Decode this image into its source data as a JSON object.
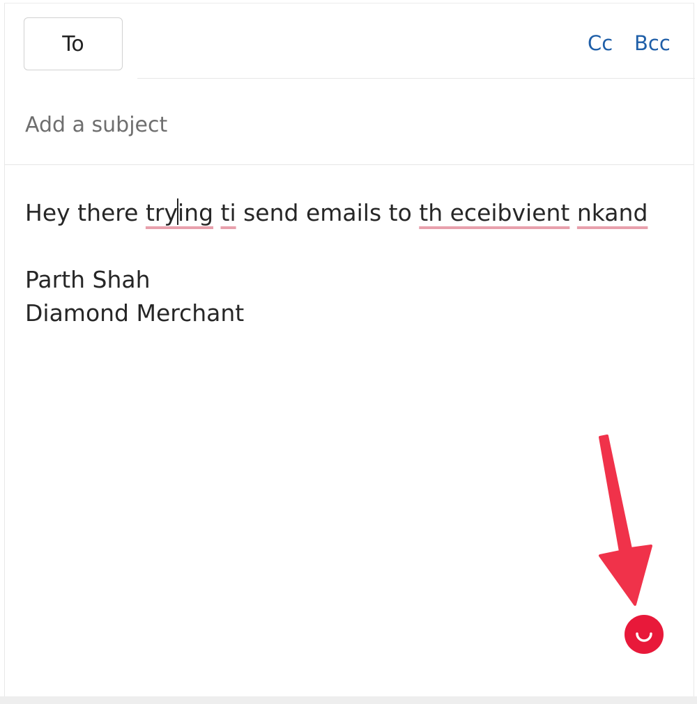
{
  "header": {
    "to_label": "To",
    "cc_label": "Cc",
    "bcc_label": "Bcc"
  },
  "subject": {
    "placeholder": "Add a subject",
    "value": ""
  },
  "body": {
    "line1": {
      "w1": "Hey there ",
      "w2a": "try",
      "w2b": "ing",
      "s1": " ",
      "w3": "ti",
      "w4": " send emails to ",
      "w5": "th eceibvient",
      "s2": " ",
      "w6": "nkand"
    },
    "signature_name": "Parth Shah",
    "signature_title": "Diamond Merchant"
  },
  "annotation": {
    "arrow_color": "#f0324a",
    "button_color": "#e8193a",
    "icon": "smile-icon"
  }
}
